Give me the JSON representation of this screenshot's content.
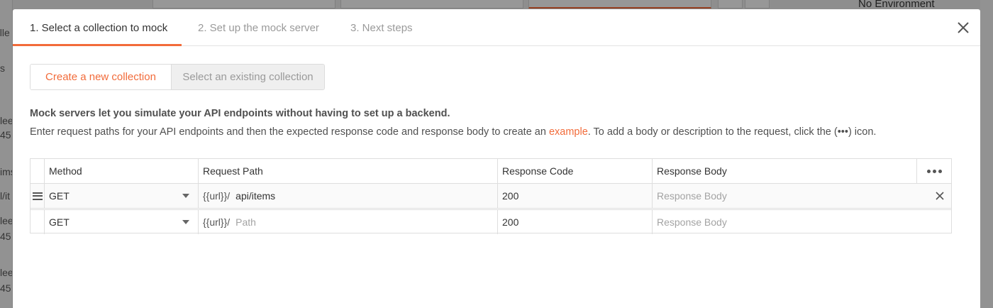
{
  "background": {
    "left_fragments": [
      "olle",
      "s",
      "lee",
      "45",
      "ims",
      "l/it",
      "lee",
      "45",
      "lee",
      "45"
    ],
    "environment": "No Environment"
  },
  "tabs": [
    {
      "label": "1. Select a collection to mock",
      "active": true
    },
    {
      "label": "2. Set up the mock server",
      "active": false
    },
    {
      "label": "3. Next steps",
      "active": false
    }
  ],
  "toggle": {
    "new_label": "Create a new collection",
    "existing_label": "Select an existing collection",
    "selected": "new"
  },
  "description": {
    "title": "Mock servers let you simulate your API endpoints without having to set up a backend.",
    "body_before": "Enter request paths for your API endpoints and then the expected response code and response body to create an ",
    "link": "example",
    "body_after": ". To add a body or description to the request, click the (•••) icon."
  },
  "table": {
    "headers": {
      "method": "Method",
      "path": "Request Path",
      "code": "Response Code",
      "body": "Response Body"
    },
    "rows": [
      {
        "method": "GET",
        "prefix": "{{url}}/",
        "path": "api/items",
        "path_placeholder": "Path",
        "code": "200",
        "body_placeholder": "Response Body"
      },
      {
        "method": "GET",
        "prefix": "{{url}}/",
        "path": "",
        "path_placeholder": "Path",
        "code": "200",
        "body_placeholder": "Response Body"
      }
    ]
  },
  "colors": {
    "accent": "#f26b3a",
    "muted_text": "#9a9a9a",
    "border": "#dedede"
  }
}
